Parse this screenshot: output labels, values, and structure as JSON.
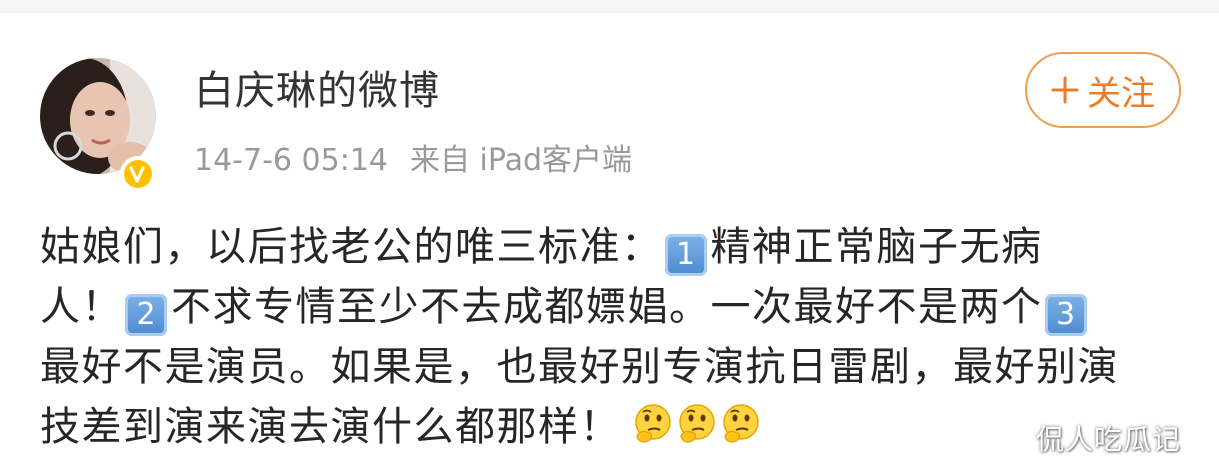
{
  "post": {
    "author_name": "白庆琳的微博",
    "verified_icon": "verified-v-badge",
    "timestamp": "14-7-6 05:14",
    "source": "来自 iPad客户端",
    "follow_label": "关注",
    "text_lines": [
      {
        "before": "姑娘们，以后找老公的唯三标准：",
        "keycap": "1",
        "after": "精神正常脑子无病"
      },
      {
        "before": "人！",
        "keycap": "2",
        "after": "不求专情至少不去成都嫖娼。一次最好不是两个",
        "keycap2": "3"
      },
      {
        "text": "最好不是演员。如果是，也最好别专演抗日雷剧，最好别演"
      },
      {
        "text": "技差到演来演去演什么都那样！"
      }
    ],
    "emojis": [
      "thinking-face-emoji",
      "thinking-face-emoji",
      "thinking-face-emoji"
    ]
  },
  "colors": {
    "accent": "#f07b22",
    "verified": "#ffc000",
    "text": "#262626",
    "meta": "#999999"
  },
  "watermark": "侃人吃瓜记"
}
